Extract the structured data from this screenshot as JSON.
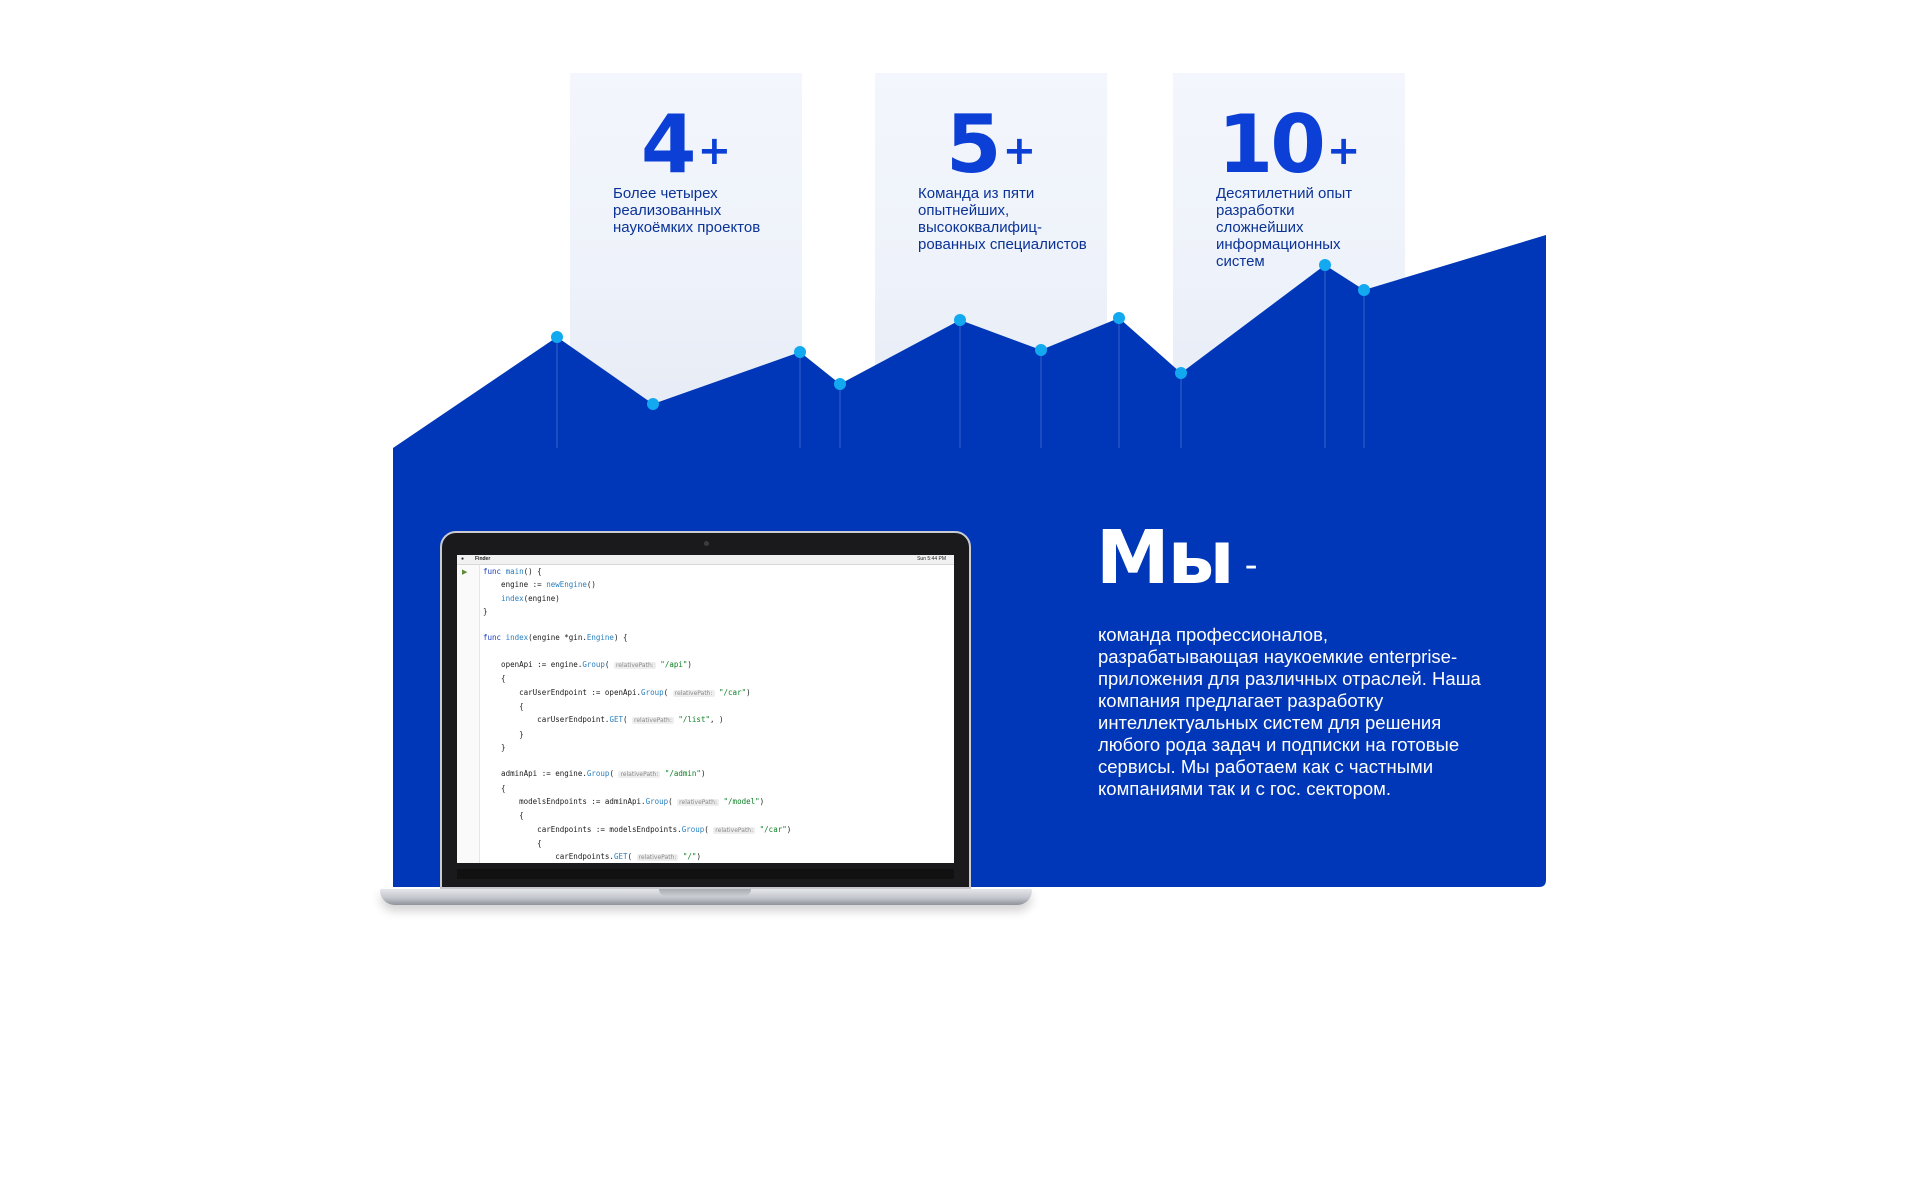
{
  "colors": {
    "brand_blue": "#0037b8",
    "accent_dot": "#12a9f0",
    "stat_number": "#0b3fd6",
    "stat_text": "#0b3396"
  },
  "stats": [
    {
      "number": "4",
      "plus": "+",
      "description": "Более четырех реализованных наукоёмких проектов"
    },
    {
      "number": "5",
      "plus": "+",
      "description": "Команда из пяти опытнейших, высококвалифиц-рованных специалистов"
    },
    {
      "number": "10",
      "plus": "+",
      "description": "Десятилетний опыт разработки сложнейших информационных систем"
    }
  ],
  "about": {
    "heading": "Мы",
    "dash": "-",
    "body": "команда профессионалов, разрабатывающая наукоемкие enterprise-приложения для различных отраслей. Наша компания предлагает разработку интеллектуальных систем для решения любого рода задач и подписки на готовые сервисы. Мы работаем как с частными компаниями так и с гос. сектором."
  },
  "laptop": {
    "menubar_app": "Finder",
    "menubar_clock": "Sun 5:44 PM",
    "code_lines": [
      [
        [
          "kw",
          "func "
        ],
        [
          "fn",
          "main"
        ],
        [
          "",
          "() {"
        ]
      ],
      [
        [
          "",
          "    engine := "
        ],
        [
          "fn",
          "newEngine"
        ],
        [
          "",
          "()"
        ]
      ],
      [
        [
          "",
          "    "
        ],
        [
          "fn",
          "index"
        ],
        [
          "",
          "(engine)"
        ]
      ],
      [
        [
          "",
          "}"
        ]
      ],
      [
        [
          "",
          ""
        ]
      ],
      [
        [
          "kw",
          "func "
        ],
        [
          "fn",
          "index"
        ],
        [
          "",
          "(engine *gin."
        ],
        [
          "fn",
          "Engine"
        ],
        [
          "",
          ") {"
        ]
      ],
      [
        [
          "",
          ""
        ]
      ],
      [
        [
          "",
          "    openApi := engine."
        ],
        [
          "fn",
          "Group"
        ],
        [
          "",
          "( "
        ],
        [
          "hint",
          "relativePath:"
        ],
        [
          "str",
          " \"/api\""
        ],
        [
          "",
          ")"
        ]
      ],
      [
        [
          "",
          "    {"
        ]
      ],
      [
        [
          "",
          "        carUserEndpoint := openApi."
        ],
        [
          "fn",
          "Group"
        ],
        [
          "",
          "( "
        ],
        [
          "hint",
          "relativePath:"
        ],
        [
          "str",
          " \"/car\""
        ],
        [
          "",
          ")"
        ]
      ],
      [
        [
          "",
          "        {"
        ]
      ],
      [
        [
          "",
          "            carUserEndpoint."
        ],
        [
          "fn",
          "GET"
        ],
        [
          "",
          "( "
        ],
        [
          "hint",
          "relativePath:"
        ],
        [
          "str",
          " \"/list\""
        ],
        [
          "",
          ", )"
        ]
      ],
      [
        [
          "",
          "        }"
        ]
      ],
      [
        [
          "",
          "    }"
        ]
      ],
      [
        [
          "",
          ""
        ]
      ],
      [
        [
          "",
          "    adminApi := engine."
        ],
        [
          "fn",
          "Group"
        ],
        [
          "",
          "( "
        ],
        [
          "hint",
          "relativePath:"
        ],
        [
          "str",
          " \"/admin\""
        ],
        [
          "",
          ")"
        ]
      ],
      [
        [
          "",
          "    {"
        ]
      ],
      [
        [
          "",
          "        modelsEndpoints := adminApi."
        ],
        [
          "fn",
          "Group"
        ],
        [
          "",
          "( "
        ],
        [
          "hint",
          "relativePath:"
        ],
        [
          "str",
          " \"/model\""
        ],
        [
          "",
          ")"
        ]
      ],
      [
        [
          "",
          "        {"
        ]
      ],
      [
        [
          "",
          "            carEndpoints := modelsEndpoints."
        ],
        [
          "fn",
          "Group"
        ],
        [
          "",
          "( "
        ],
        [
          "hint",
          "relativePath:"
        ],
        [
          "str",
          " \"/car\""
        ],
        [
          "",
          ")"
        ]
      ],
      [
        [
          "",
          "            {"
        ]
      ],
      [
        [
          "",
          "                carEndpoints."
        ],
        [
          "fn",
          "GET"
        ],
        [
          "",
          "( "
        ],
        [
          "hint",
          "relativePath:"
        ],
        [
          "str",
          " \"/\""
        ],
        [
          "",
          ")"
        ]
      ]
    ]
  }
}
